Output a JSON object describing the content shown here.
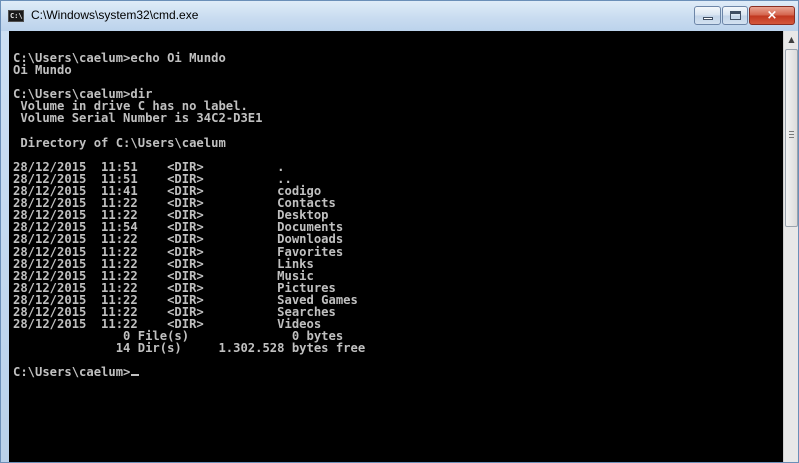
{
  "window": {
    "title": "C:\\Windows\\system32\\cmd.exe",
    "app_icon": "console-icon",
    "accent_colors": {
      "titlebar": "#c9dcf0",
      "close_button": "#c1371f",
      "console_background": "#000000",
      "console_text": "#c0c0c0"
    }
  },
  "caption_buttons": {
    "minimize_icon": "minimize-icon",
    "maximize_icon": "maximize-icon",
    "close_icon": "close-icon",
    "close_glyph": "×"
  },
  "scrollbar": {
    "up_arrow": "▲",
    "up_arrow_icon": "scroll-up-arrow-icon",
    "position": 0
  },
  "console": {
    "lines": [
      "C:\\Users\\caelum>echo Oi Mundo",
      "Oi Mundo",
      "",
      "C:\\Users\\caelum>dir",
      " Volume in drive C has no label.",
      " Volume Serial Number is 34C2-D3E1",
      "",
      " Directory of C:\\Users\\caelum",
      "",
      "28/12/2015  11:51    <DIR>          .",
      "28/12/2015  11:51    <DIR>          ..",
      "28/12/2015  11:41    <DIR>          codigo",
      "28/12/2015  11:22    <DIR>          Contacts",
      "28/12/2015  11:22    <DIR>          Desktop",
      "28/12/2015  11:54    <DIR>          Documents",
      "28/12/2015  11:22    <DIR>          Downloads",
      "28/12/2015  11:22    <DIR>          Favorites",
      "28/12/2015  11:22    <DIR>          Links",
      "28/12/2015  11:22    <DIR>          Music",
      "28/12/2015  11:22    <DIR>          Pictures",
      "28/12/2015  11:22    <DIR>          Saved Games",
      "28/12/2015  11:22    <DIR>          Searches",
      "28/12/2015  11:22    <DIR>          Videos",
      "               0 File(s)              0 bytes",
      "              14 Dir(s)     1.302.528 bytes free",
      ""
    ],
    "prompt": "C:\\Users\\caelum>"
  }
}
